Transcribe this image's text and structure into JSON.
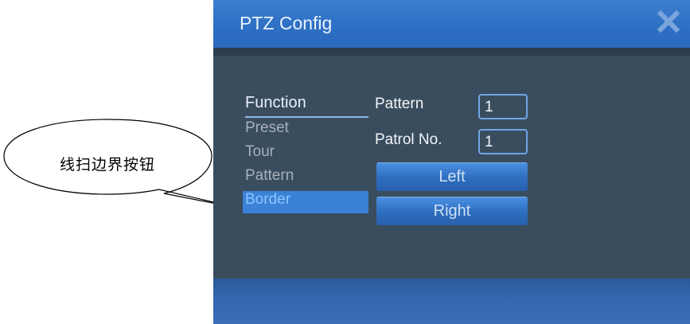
{
  "callout": {
    "text": "线扫边界按钮"
  },
  "dialog": {
    "title": "PTZ Config",
    "close_icon": "close-icon"
  },
  "functions": {
    "header": "Function",
    "items": [
      "Preset",
      "Tour",
      "Pattern",
      "Border"
    ],
    "selected": "Border"
  },
  "form": {
    "pattern_label": "Pattern",
    "pattern_value": "1",
    "patrol_label": "Patrol No.",
    "patrol_value": "1"
  },
  "buttons": {
    "left": "Left",
    "right": "Right"
  },
  "colors": {
    "title_bar": "#2f72c6",
    "content_bg": "#3a4d5e",
    "selected_item": "#3b82d6",
    "field_border": "#6ea7e6"
  }
}
